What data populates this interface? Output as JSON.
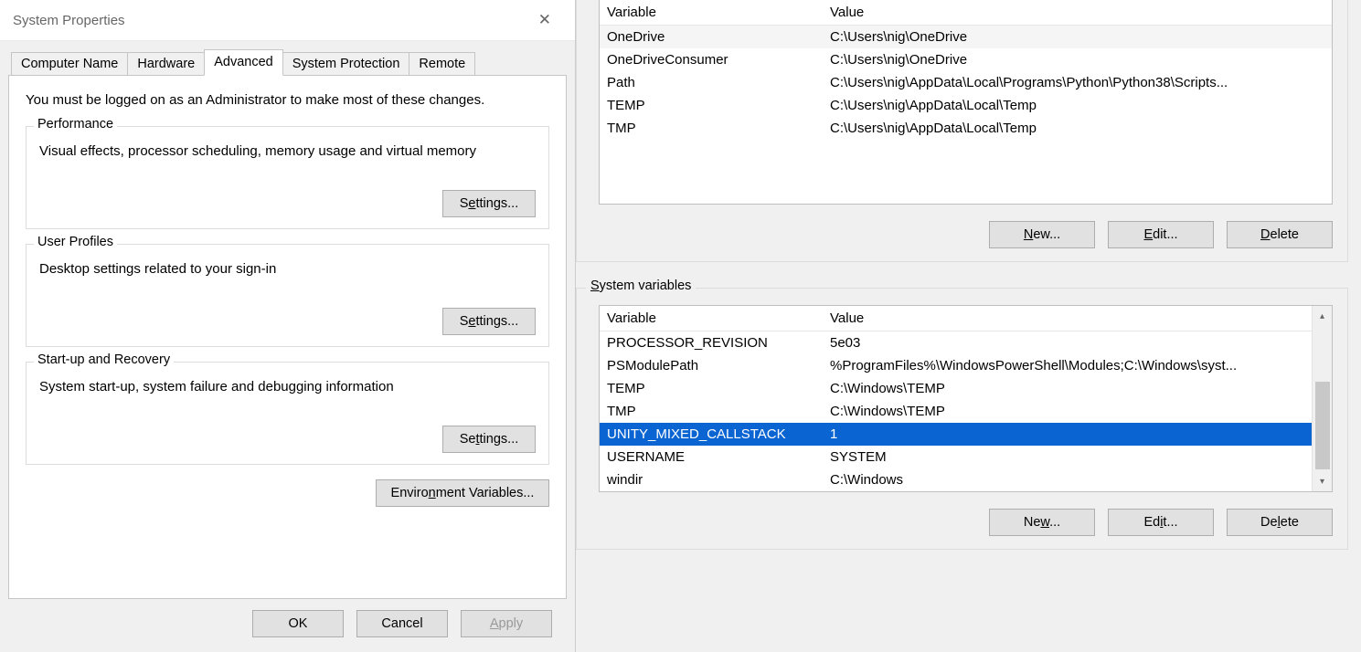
{
  "syswin": {
    "title": "System Properties",
    "tabs": [
      "Computer Name",
      "Hardware",
      "Advanced",
      "System Protection",
      "Remote"
    ],
    "active_tab_index": 2,
    "admin_note": "You must be logged on as an Administrator to make most of these changes.",
    "groups": {
      "perf": {
        "legend": "Performance",
        "desc": "Visual effects, processor scheduling, memory usage and virtual memory",
        "button": "Settings..."
      },
      "profiles": {
        "legend": "User Profiles",
        "desc": "Desktop settings related to your sign-in",
        "button": "Settings..."
      },
      "startup": {
        "legend": "Start-up and Recovery",
        "desc": "System start-up, system failure and debugging information",
        "button": "Settings..."
      }
    },
    "env_button": "Environment Variables...",
    "buttons": {
      "ok": "OK",
      "cancel": "Cancel",
      "apply": "Apply"
    }
  },
  "env": {
    "headers": {
      "variable": "Variable",
      "value": "Value"
    },
    "user_vars": [
      {
        "name": "OneDrive",
        "value": "C:\\Users\\nig\\OneDrive",
        "hover": true
      },
      {
        "name": "OneDriveConsumer",
        "value": "C:\\Users\\nig\\OneDrive"
      },
      {
        "name": "Path",
        "value": "C:\\Users\\nig\\AppData\\Local\\Programs\\Python\\Python38\\Scripts..."
      },
      {
        "name": "TEMP",
        "value": "C:\\Users\\nig\\AppData\\Local\\Temp"
      },
      {
        "name": "TMP",
        "value": "C:\\Users\\nig\\AppData\\Local\\Temp"
      }
    ],
    "user_buttons": {
      "new": "New...",
      "edit": "Edit...",
      "delete": "Delete"
    },
    "sys_legend": "System variables",
    "sys_vars": [
      {
        "name": "PROCESSOR_REVISION",
        "value": "5e03"
      },
      {
        "name": "PSModulePath",
        "value": "%ProgramFiles%\\WindowsPowerShell\\Modules;C:\\Windows\\syst..."
      },
      {
        "name": "TEMP",
        "value": "C:\\Windows\\TEMP"
      },
      {
        "name": "TMP",
        "value": "C:\\Windows\\TEMP"
      },
      {
        "name": "UNITY_MIXED_CALLSTACK",
        "value": "1",
        "selected": true
      },
      {
        "name": "USERNAME",
        "value": "SYSTEM"
      },
      {
        "name": "windir",
        "value": "C:\\Windows"
      }
    ],
    "sys_buttons": {
      "new": "New...",
      "edit": "Edit...",
      "delete": "Delete"
    }
  }
}
